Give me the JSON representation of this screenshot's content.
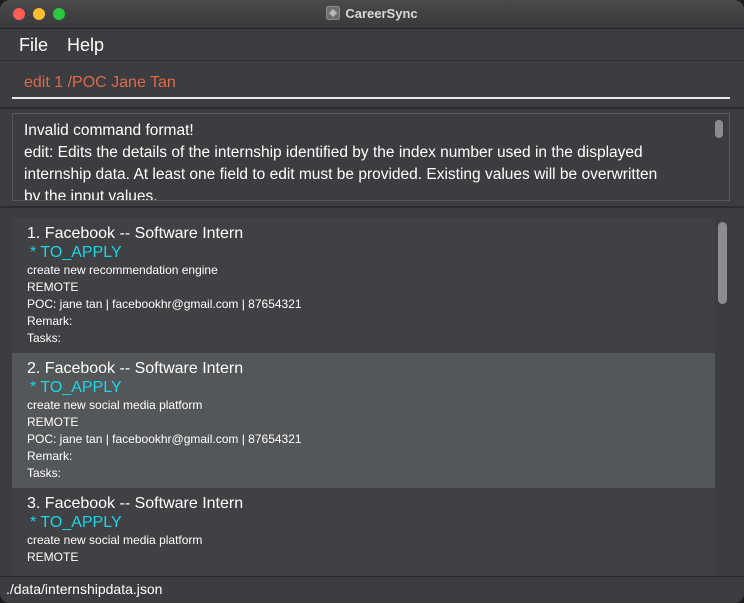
{
  "window": {
    "title": "CareerSync"
  },
  "menu": {
    "file": "File",
    "help": "Help"
  },
  "command": {
    "value": "edit 1 /POC Jane Tan"
  },
  "result": {
    "line1": "Invalid command format!",
    "line2": "edit: Edits the details of the internship identified by the index number used in the displayed",
    "line3": "internship data. At least one field to edit must be provided. Existing values will be overwritten",
    "line4": "by the input values."
  },
  "internships": [
    {
      "title": "1.  Facebook -- Software Intern",
      "status": "* TO_APPLY",
      "description": "create new recommendation engine",
      "location": "REMOTE",
      "poc": "POC: jane tan | facebookhr@gmail.com | 87654321",
      "remark": "Remark:",
      "tasks": "Tasks:"
    },
    {
      "title": "2.  Facebook -- Software Intern",
      "status": "* TO_APPLY",
      "description": "create new social media platform",
      "location": "REMOTE",
      "poc": "POC: jane tan | facebookhr@gmail.com | 87654321",
      "remark": "Remark:",
      "tasks": "Tasks:"
    },
    {
      "title": "3.  Facebook -- Software Intern",
      "status": "* TO_APPLY",
      "description": "create new social media platform",
      "location": "REMOTE",
      "poc": "",
      "remark": "",
      "tasks": ""
    }
  ],
  "status_bar": {
    "path": "./data/internshipdata.json"
  },
  "colors": {
    "accent_status": "#19d7e6",
    "command_text": "#e0694a"
  }
}
